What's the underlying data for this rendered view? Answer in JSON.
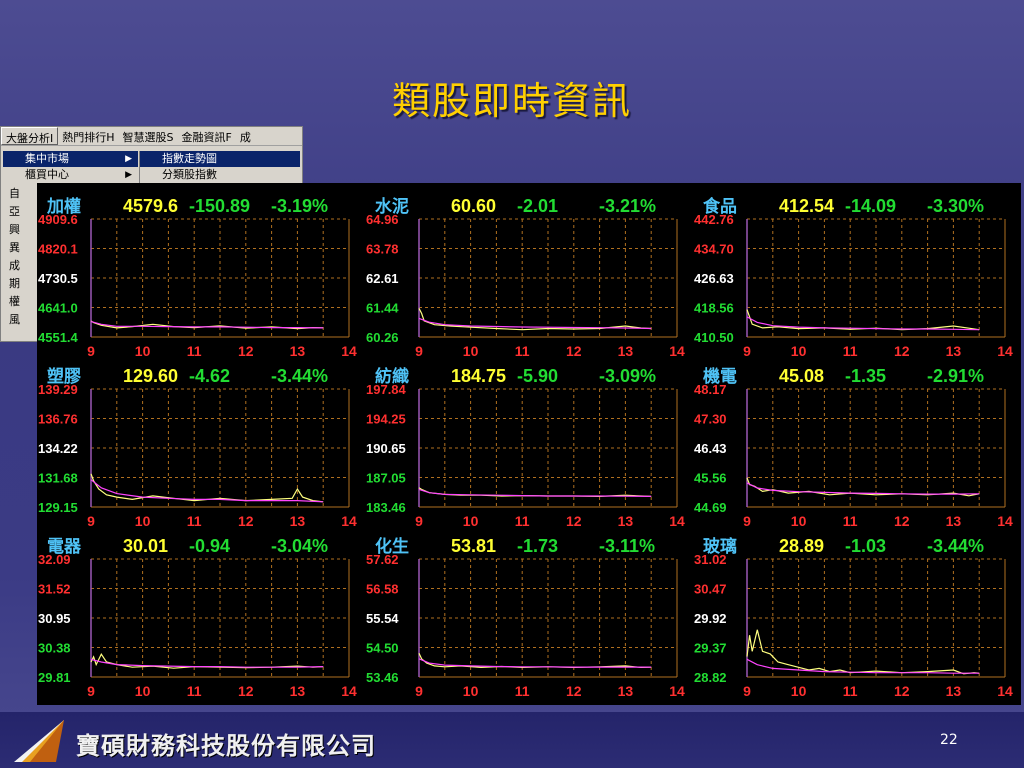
{
  "slide": {
    "title": "類股即時資訊",
    "page_number": "22",
    "company": "寶碩財務科技股份有限公司"
  },
  "menu": {
    "bar": [
      "大盤分析I",
      "熱門排行H",
      "智慧選股S",
      "金融資訊F",
      "成"
    ],
    "col1": [
      {
        "label": "集中市場",
        "selected": true
      },
      {
        "label": "櫃買中心",
        "selected": false
      }
    ],
    "col1_more": [
      "自",
      "亞",
      "興",
      "異",
      "成",
      "期",
      "權",
      "風"
    ],
    "col2": [
      {
        "label": "指數走勢圖",
        "selected": true
      },
      {
        "label": "分類股指數",
        "selected": false
      }
    ]
  },
  "colors": {
    "title": "#ffd000",
    "up": "#ff3030",
    "down": "#22dd33",
    "price": "#ffff33",
    "grid": "#b07020",
    "line_yellow": "#ffff80",
    "line_magenta": "#ff44ff",
    "name": "#4fc3f7"
  },
  "chart_data": [
    {
      "type": "line",
      "title": "加權",
      "price": "4579.6",
      "change": "-150.89",
      "pct": "-3.19%",
      "yticks": [
        "4909.6",
        "4820.1",
        "4730.5",
        "4641.0",
        "4551.4"
      ],
      "ylim": [
        4551.4,
        4909.6
      ],
      "xticks": [
        "9",
        "10",
        "11",
        "12",
        "13",
        "14"
      ],
      "xlim": [
        9,
        14
      ],
      "series": [
        {
          "color": "yellow",
          "x": [
            9,
            9.05,
            9.2,
            9.5,
            9.8,
            10.2,
            10.6,
            11,
            11.5,
            12,
            12.5,
            13,
            13.3,
            13.5
          ],
          "y": [
            4600,
            4595,
            4587,
            4579,
            4583,
            4590,
            4583,
            4580,
            4585,
            4578,
            4582,
            4577,
            4580,
            4579
          ]
        },
        {
          "color": "magenta",
          "x": [
            9,
            9.2,
            9.5,
            10,
            10.5,
            11,
            11.5,
            12,
            12.5,
            13,
            13.5
          ],
          "y": [
            4598,
            4590,
            4584,
            4584,
            4583,
            4582,
            4582,
            4581,
            4580,
            4580,
            4579
          ]
        }
      ]
    },
    {
      "type": "line",
      "title": "水泥",
      "price": "60.60",
      "change": "-2.01",
      "pct": "-3.21%",
      "yticks": [
        "64.96",
        "63.78",
        "62.61",
        "61.44",
        "60.26"
      ],
      "ylim": [
        60.26,
        64.96
      ],
      "xticks": [
        "9",
        "10",
        "11",
        "12",
        "13",
        "14"
      ],
      "xlim": [
        9,
        14
      ],
      "series": [
        {
          "color": "yellow",
          "x": [
            9,
            9.05,
            9.1,
            9.3,
            9.6,
            10,
            10.5,
            11,
            11.5,
            12,
            12.5,
            13,
            13.3,
            13.5
          ],
          "y": [
            61.4,
            61.2,
            60.9,
            60.75,
            60.7,
            60.65,
            60.6,
            60.55,
            60.6,
            60.58,
            60.6,
            60.7,
            60.62,
            60.6
          ]
        },
        {
          "color": "magenta",
          "x": [
            9,
            9.2,
            9.5,
            10,
            10.5,
            11,
            11.5,
            12,
            12.5,
            13,
            13.5
          ],
          "y": [
            61.0,
            60.85,
            60.75,
            60.7,
            60.68,
            60.66,
            60.65,
            60.64,
            60.63,
            60.62,
            60.6
          ]
        }
      ]
    },
    {
      "type": "line",
      "title": "食品",
      "price": "412.54",
      "change": "-14.09",
      "pct": "-3.30%",
      "yticks": [
        "442.76",
        "434.70",
        "426.63",
        "418.56",
        "410.50"
      ],
      "ylim": [
        410.5,
        442.76
      ],
      "xticks": [
        "9",
        "10",
        "11",
        "12",
        "13",
        "14"
      ],
      "xlim": [
        9,
        14
      ],
      "series": [
        {
          "color": "yellow",
          "x": [
            9,
            9.05,
            9.1,
            9.3,
            9.6,
            10,
            10.5,
            11,
            11.5,
            12,
            12.5,
            13,
            13.3,
            13.5
          ],
          "y": [
            418,
            416,
            414,
            413,
            413.3,
            412.8,
            413,
            412.6,
            412.9,
            412.5,
            412.8,
            413.5,
            412.9,
            412.5
          ]
        },
        {
          "color": "magenta",
          "x": [
            9,
            9.2,
            9.5,
            10,
            10.5,
            11,
            11.5,
            12,
            12.5,
            13,
            13.5
          ],
          "y": [
            416,
            414.5,
            413.6,
            413.2,
            413,
            412.9,
            412.8,
            412.7,
            412.7,
            412.6,
            412.5
          ]
        }
      ]
    },
    {
      "type": "line",
      "title": "塑膠",
      "price": "129.60",
      "change": "-4.62",
      "pct": "-3.44%",
      "yticks": [
        "139.29",
        "136.76",
        "134.22",
        "131.68",
        "129.15"
      ],
      "ylim": [
        129.15,
        139.29
      ],
      "xticks": [
        "9",
        "10",
        "11",
        "12",
        "13",
        "14"
      ],
      "xlim": [
        9,
        14
      ],
      "series": [
        {
          "color": "yellow",
          "x": [
            9,
            9.05,
            9.15,
            9.3,
            9.5,
            9.8,
            10.2,
            10.6,
            11,
            11.5,
            12,
            12.5,
            12.9,
            13,
            13.1,
            13.3,
            13.5
          ],
          "y": [
            132,
            131.4,
            130.7,
            130.2,
            130,
            129.8,
            130.1,
            129.9,
            129.7,
            129.9,
            129.7,
            129.8,
            129.9,
            130.7,
            130,
            129.7,
            129.6
          ]
        },
        {
          "color": "magenta",
          "x": [
            9,
            9.2,
            9.5,
            10,
            10.5,
            11,
            11.5,
            12,
            12.5,
            13,
            13.5
          ],
          "y": [
            131.5,
            130.8,
            130.3,
            130,
            129.9,
            129.8,
            129.8,
            129.7,
            129.7,
            129.7,
            129.6
          ]
        }
      ]
    },
    {
      "type": "line",
      "title": "紡織",
      "price": "184.75",
      "change": "-5.90",
      "pct": "-3.09%",
      "yticks": [
        "197.84",
        "194.25",
        "190.65",
        "187.05",
        "183.46"
      ],
      "ylim": [
        183.46,
        197.84
      ],
      "xticks": [
        "9",
        "10",
        "11",
        "12",
        "13",
        "14"
      ],
      "xlim": [
        9,
        14
      ],
      "series": [
        {
          "color": "yellow",
          "x": [
            9,
            9.05,
            9.2,
            9.5,
            9.8,
            10.2,
            10.6,
            11,
            11.5,
            12,
            12.5,
            13,
            13.3,
            13.5
          ],
          "y": [
            185.8,
            185.6,
            185.2,
            185,
            184.9,
            184.9,
            184.8,
            184.85,
            184.8,
            184.8,
            184.75,
            184.9,
            184.8,
            184.75
          ]
        },
        {
          "color": "magenta",
          "x": [
            9,
            9.2,
            9.5,
            10,
            10.5,
            11,
            11.5,
            12,
            12.5,
            13,
            13.5
          ],
          "y": [
            185.6,
            185.2,
            185,
            184.95,
            184.9,
            184.85,
            184.8,
            184.8,
            184.8,
            184.78,
            184.75
          ]
        }
      ]
    },
    {
      "type": "line",
      "title": "機電",
      "price": "45.08",
      "change": "-1.35",
      "pct": "-2.91%",
      "yticks": [
        "48.17",
        "47.30",
        "46.43",
        "45.56",
        "44.69"
      ],
      "ylim": [
        44.69,
        48.17
      ],
      "xticks": [
        "9",
        "10",
        "11",
        "12",
        "13",
        "14"
      ],
      "xlim": [
        9,
        14
      ],
      "series": [
        {
          "color": "yellow",
          "x": [
            9,
            9.05,
            9.15,
            9.3,
            9.5,
            9.8,
            10.2,
            10.6,
            11,
            11.5,
            12,
            12.5,
            13,
            13.3,
            13.5
          ],
          "y": [
            45.55,
            45.35,
            45.3,
            45.15,
            45.2,
            45.1,
            45.15,
            45.05,
            45.1,
            45.05,
            45.08,
            45.05,
            45.1,
            45.02,
            45.08
          ]
        },
        {
          "color": "magenta",
          "x": [
            9,
            9.2,
            9.5,
            10,
            10.5,
            11,
            11.5,
            12,
            12.5,
            13,
            13.5
          ],
          "y": [
            45.4,
            45.25,
            45.18,
            45.14,
            45.12,
            45.1,
            45.09,
            45.08,
            45.07,
            45.07,
            45.08
          ]
        }
      ]
    },
    {
      "type": "line",
      "title": "電器",
      "price": "30.01",
      "change": "-0.94",
      "pct": "-3.04%",
      "yticks": [
        "32.09",
        "31.52",
        "30.95",
        "30.38",
        "29.81"
      ],
      "ylim": [
        29.81,
        32.09
      ],
      "xticks": [
        "9",
        "10",
        "11",
        "12",
        "13",
        "14"
      ],
      "xlim": [
        9,
        14
      ],
      "series": [
        {
          "color": "yellow",
          "x": [
            9,
            9.05,
            9.1,
            9.2,
            9.3,
            9.5,
            9.8,
            10.2,
            10.6,
            11,
            11.5,
            12,
            12.5,
            13,
            13.3,
            13.5
          ],
          "y": [
            30.1,
            30.2,
            30.05,
            30.25,
            30.1,
            30.05,
            30.0,
            30.02,
            29.98,
            30.01,
            30.0,
            29.99,
            30.0,
            30.02,
            30.0,
            30.01
          ]
        },
        {
          "color": "magenta",
          "x": [
            9,
            9.2,
            9.5,
            10,
            10.5,
            11,
            11.5,
            12,
            12.5,
            13,
            13.5
          ],
          "y": [
            30.15,
            30.1,
            30.05,
            30.03,
            30.02,
            30.01,
            30.01,
            30.0,
            30.0,
            30.0,
            30.01
          ]
        }
      ]
    },
    {
      "type": "line",
      "title": "化生",
      "price": "53.81",
      "change": "-1.73",
      "pct": "-3.11%",
      "yticks": [
        "57.62",
        "56.58",
        "55.54",
        "54.50",
        "53.46"
      ],
      "ylim": [
        53.46,
        57.62
      ],
      "xticks": [
        "9",
        "10",
        "11",
        "12",
        "13",
        "14"
      ],
      "xlim": [
        9,
        14
      ],
      "series": [
        {
          "color": "yellow",
          "x": [
            9,
            9.05,
            9.15,
            9.3,
            9.5,
            9.8,
            10.2,
            10.6,
            11,
            11.5,
            12,
            12.5,
            13,
            13.3,
            13.5
          ],
          "y": [
            54.3,
            54.1,
            53.95,
            53.85,
            53.82,
            53.85,
            53.8,
            53.83,
            53.8,
            53.82,
            53.8,
            53.82,
            53.85,
            53.8,
            53.81
          ]
        },
        {
          "color": "magenta",
          "x": [
            9,
            9.2,
            9.5,
            10,
            10.5,
            11,
            11.5,
            12,
            12.5,
            13,
            13.5
          ],
          "y": [
            54.1,
            53.95,
            53.88,
            53.85,
            53.83,
            53.82,
            53.82,
            53.81,
            53.81,
            53.81,
            53.81
          ]
        }
      ]
    },
    {
      "type": "line",
      "title": "玻璃",
      "price": "28.89",
      "change": "-1.03",
      "pct": "-3.44%",
      "yticks": [
        "31.02",
        "30.47",
        "29.92",
        "29.37",
        "28.82"
      ],
      "ylim": [
        28.82,
        31.02
      ],
      "xticks": [
        "9",
        "10",
        "11",
        "12",
        "13",
        "14"
      ],
      "xlim": [
        9,
        14
      ],
      "series": [
        {
          "color": "yellow",
          "x": [
            9,
            9.05,
            9.1,
            9.2,
            9.3,
            9.45,
            9.6,
            9.8,
            10,
            10.2,
            10.4,
            10.6,
            10.8,
            11,
            11.5,
            12,
            12.5,
            13,
            13.2,
            13.4,
            13.5
          ],
          "y": [
            29.2,
            29.6,
            29.3,
            29.7,
            29.3,
            29.25,
            29.1,
            29.05,
            29.0,
            28.95,
            28.98,
            28.92,
            28.95,
            28.9,
            28.93,
            28.9,
            28.92,
            28.95,
            28.88,
            28.9,
            28.89
          ]
        },
        {
          "color": "magenta",
          "x": [
            9,
            9.2,
            9.5,
            10,
            10.5,
            11,
            11.5,
            12,
            12.5,
            13,
            13.5
          ],
          "y": [
            29.15,
            29.05,
            28.98,
            28.95,
            28.92,
            28.91,
            28.9,
            28.9,
            28.9,
            28.89,
            28.89
          ]
        }
      ]
    }
  ]
}
